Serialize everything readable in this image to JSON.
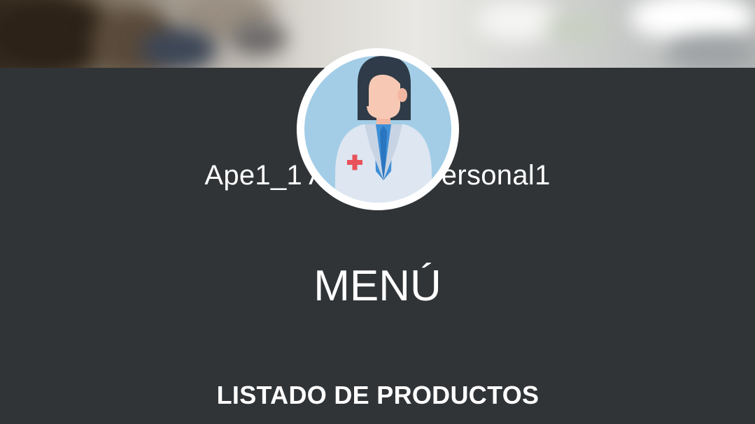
{
  "profile": {
    "avatar_icon": "doctor-avatar-icon",
    "user_name": "Ape1_1 Ape2_1, Personal1"
  },
  "menu": {
    "title": "MENÚ",
    "items": [
      {
        "label": "LISTADO DE PRODUCTOS"
      }
    ]
  },
  "colors": {
    "background": "#313437",
    "text": "#ffffff",
    "avatar_bg": "#a3cde7",
    "avatar_border": "#ffffff"
  }
}
